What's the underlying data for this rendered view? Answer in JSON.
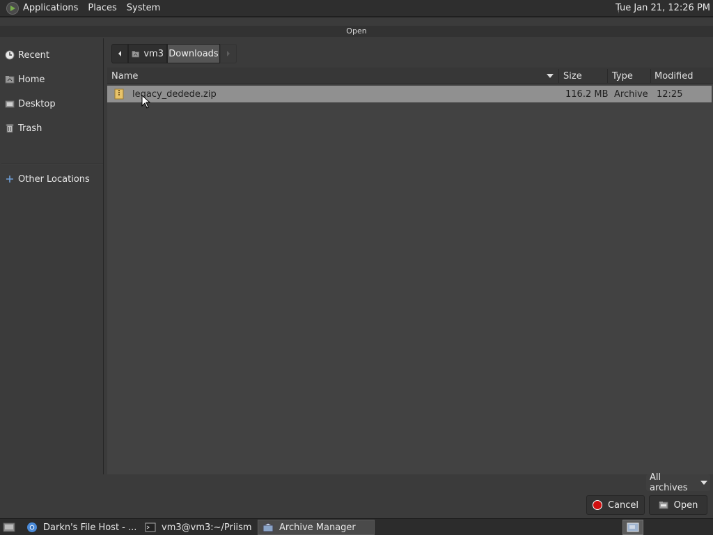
{
  "top_panel": {
    "menus": [
      "Applications",
      "Places",
      "System"
    ],
    "clock": "Tue Jan 21, 12:26 PM"
  },
  "dialog": {
    "title": "Open",
    "sidebar": [
      {
        "label": "Recent",
        "icon": "recent-icon"
      },
      {
        "label": "Home",
        "icon": "home-folder-icon"
      },
      {
        "label": "Desktop",
        "icon": "desktop-icon"
      },
      {
        "label": "Trash",
        "icon": "trash-icon"
      },
      {
        "label": "Other Locations",
        "icon": "plus-icon"
      }
    ],
    "pathbar": {
      "home": "vm3",
      "current": "Downloads"
    },
    "columns": {
      "name": "Name",
      "size": "Size",
      "type": "Type",
      "modified": "Modified"
    },
    "files": [
      {
        "name": "legacy_dedede.zip",
        "size": "116.2 MB",
        "type": "Archive",
        "modified": "12:25",
        "icon": "zip-archive-icon"
      }
    ],
    "filter": "All archives",
    "buttons": {
      "cancel": "Cancel",
      "open": "Open"
    }
  },
  "taskbar": {
    "tasks": [
      {
        "label": "Darkn's File Host - ...",
        "icon": "chrome-icon"
      },
      {
        "label": "vm3@vm3:~/Priism",
        "icon": "terminal-icon"
      },
      {
        "label": "Archive Manager",
        "icon": "archive-manager-icon"
      }
    ]
  }
}
